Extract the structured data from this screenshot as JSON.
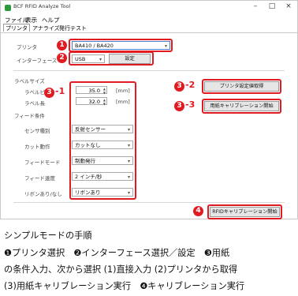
{
  "window": {
    "title": "BCF RFID Analyze Tool",
    "controls": {
      "min": "–",
      "max": "□",
      "close": "×"
    }
  },
  "menu": [
    "ファイル",
    "表示",
    "ヘルプ"
  ],
  "tabs": [
    "プリンタ",
    "アナライズ",
    "発行テスト"
  ],
  "printer": {
    "label": "プリンタ",
    "value": "BA410 / BA420"
  },
  "interface": {
    "label": "インターフェース",
    "value": "USB",
    "settings_button": "設定"
  },
  "label_size": {
    "group_label": "ラベルサイズ",
    "pitch_label": "ラベルピッチ",
    "pitch_value": "35.0",
    "length_label": "ラベル長",
    "length_value": "32.0",
    "unit": "[mm]"
  },
  "feed": {
    "group_label": "フィード条件",
    "rows": [
      {
        "label": "センサ種別",
        "value": "反射センサー"
      },
      {
        "label": "カット動作",
        "value": "カットなし"
      },
      {
        "label": "フィードモード",
        "value": "制動発行"
      },
      {
        "label": "フィード速度",
        "value": "2 インチ/秒"
      },
      {
        "label": "リボンあり/なし",
        "value": "リボンあり"
      }
    ]
  },
  "buttons": {
    "get_printer_settings": "プリンタ設定値取得",
    "paper_calibration": "用紙キャリブレーション開始",
    "rfid_calibration": "RFIDキャリブレーション開始"
  },
  "badges": {
    "b1": "1",
    "b2": "2",
    "b3_1": "3",
    "b3_1_suffix": "-1",
    "b3_2": "3",
    "b3_2_suffix": "-2",
    "b3_3": "3",
    "b3_3_suffix": "-3",
    "b4": "4"
  },
  "description": {
    "heading": "シンプルモードの手順",
    "line1": "❶プリンタ選択　❷インターフェース選択／設定　❸用紙",
    "line2": "の条件入力、次から選択 (1)直接入力 (2)プリンタから取得",
    "line3": "(3)用紙キャリブレーション実行　❹キャリブレーション実行"
  },
  "colors": {
    "accent_red": "#e11b22",
    "title_icon_green": "#2e9a3d"
  }
}
